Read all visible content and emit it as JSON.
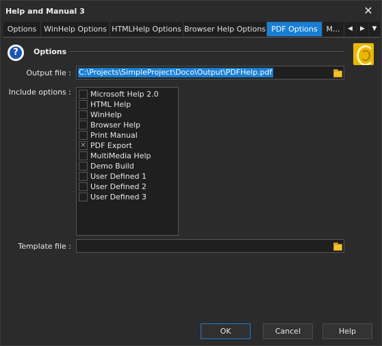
{
  "window": {
    "title": "Help and Manual 3"
  },
  "tabs": [
    {
      "label": "Options"
    },
    {
      "label": "WinHelp Options"
    },
    {
      "label": "HTMLHelp Options"
    },
    {
      "label": "Browser Help Options"
    },
    {
      "label": "PDF Options",
      "active": true
    },
    {
      "label": "M..."
    }
  ],
  "tab_scroll": {
    "left": "◀",
    "right": "▶",
    "menu": "▼"
  },
  "section": {
    "title": "Options",
    "icon": "help-icon",
    "logo": "help-and-manual-logo-icon"
  },
  "output_file": {
    "label": "Output file :",
    "value": "C:\\Projects\\SimpleProject\\Doco\\Output\\PDFHelp.pdf"
  },
  "include_options": {
    "label": "Include options :",
    "items": [
      {
        "label": "Microsoft Help 2.0",
        "checked": false
      },
      {
        "label": "HTML Help",
        "checked": false
      },
      {
        "label": "WinHelp",
        "checked": false
      },
      {
        "label": "Browser Help",
        "checked": false
      },
      {
        "label": "Print Manual",
        "checked": false
      },
      {
        "label": "PDF Export",
        "checked": true
      },
      {
        "label": "MultiMedia Help",
        "checked": false
      },
      {
        "label": "Demo Build",
        "checked": false
      },
      {
        "label": "User Defined 1",
        "checked": false
      },
      {
        "label": "User Defined 2",
        "checked": false
      },
      {
        "label": "User Defined 3",
        "checked": false
      }
    ]
  },
  "template_file": {
    "label": "Template file :",
    "value": ""
  },
  "buttons": {
    "ok": "OK",
    "cancel": "Cancel",
    "help": "Help"
  },
  "colors": {
    "accent": "#1a7fd4",
    "background": "#2b2b2b",
    "field": "#1f1f1f"
  }
}
